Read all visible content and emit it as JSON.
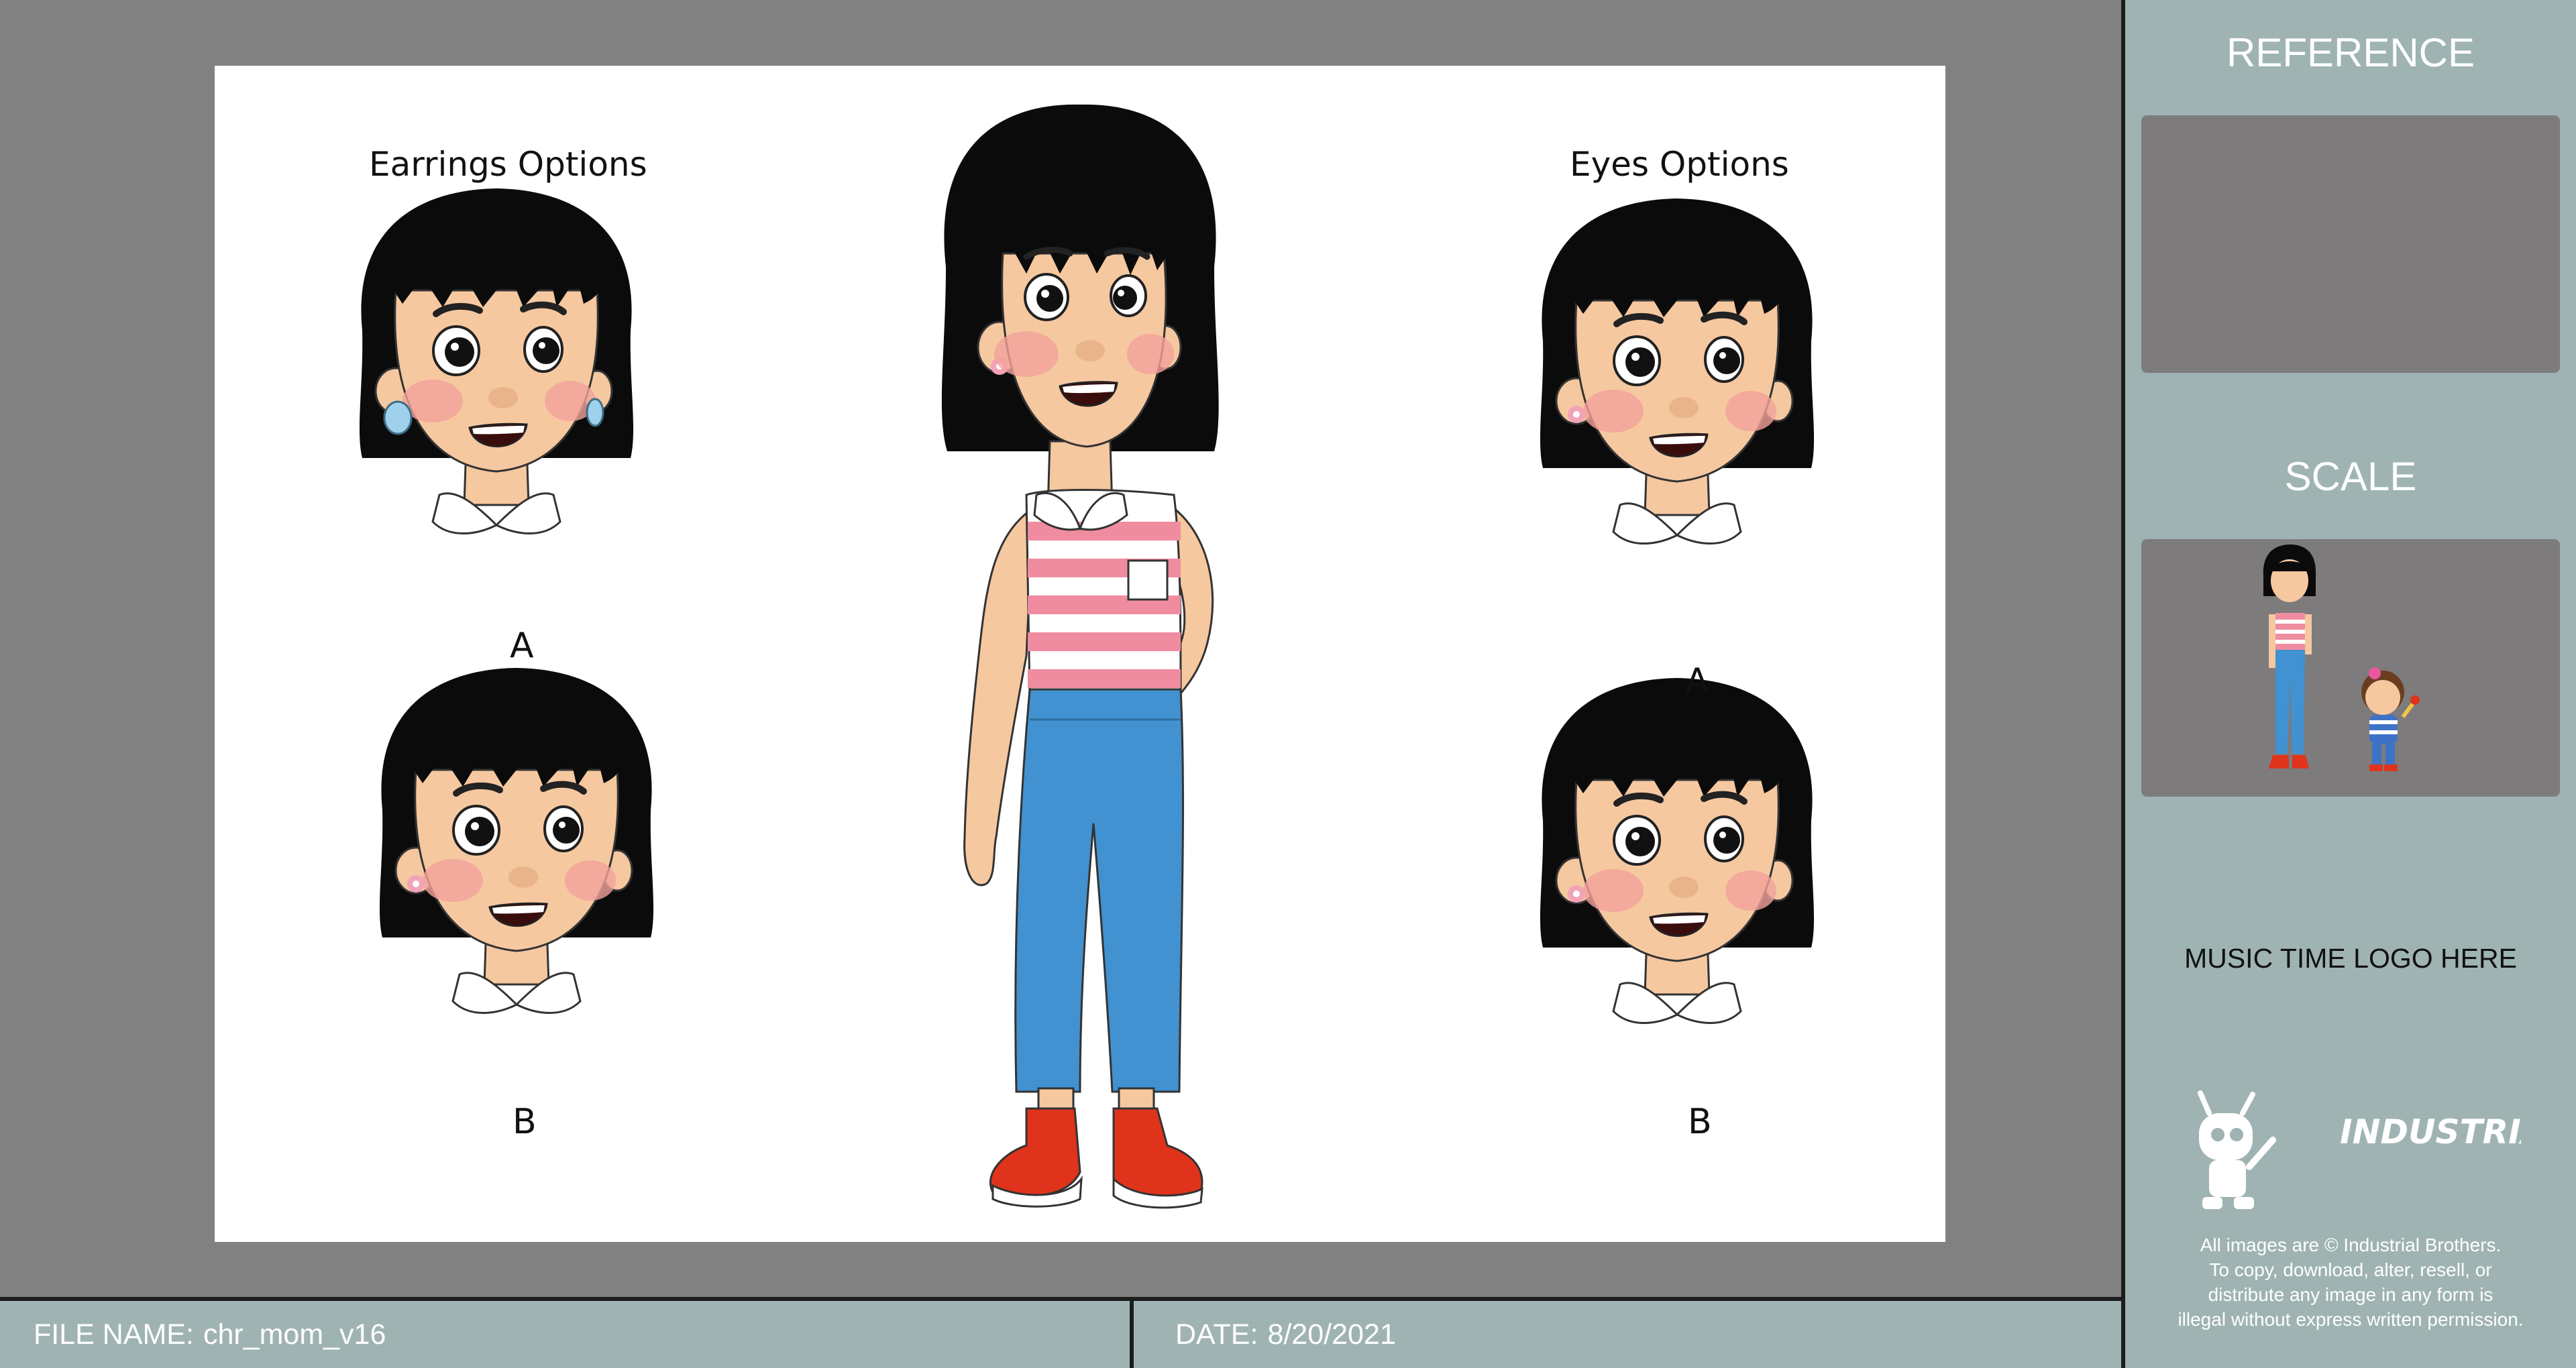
{
  "sheet": {
    "earrings_title": "Earrings Options",
    "eyes_title": "Eyes Options",
    "earrings_labels": [
      "A",
      "B"
    ],
    "eyes_labels": [
      "A",
      "B"
    ],
    "colors": {
      "hair": "#0b0b0b",
      "skin": "#f6c8a0",
      "blush": "#f3a19a",
      "shirt_pink": "#f08ca0",
      "jeans": "#4291d0",
      "shoes": "#e0331c"
    }
  },
  "sidebar": {
    "reference_label": "REFERENCE",
    "scale_label": "SCALE",
    "logo_placeholder": "MUSIC TIME LOGO HERE",
    "brand_logo": "INDUSTRIAL BROTHERS",
    "copyright": [
      "All images are © Industrial Brothers.",
      "To copy, download, alter, resell, or",
      "distribute any image in any form is",
      "illegal without express written permission."
    ]
  },
  "footer": {
    "file_name_label": "FILE NAME:",
    "file_name_value": "chr_mom_v16",
    "date_label": "DATE:",
    "date_value": "8/20/2021"
  }
}
